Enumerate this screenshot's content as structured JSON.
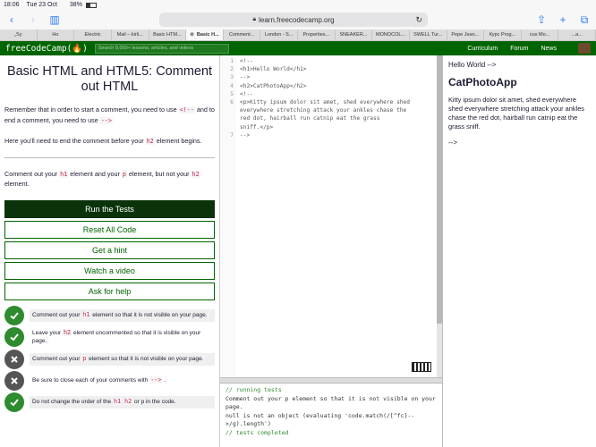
{
  "status": {
    "time": "18:06",
    "date": "Tue 23 Oct",
    "battery": "38%"
  },
  "browser": {
    "url": "learn.freecodecamp.org",
    "tabs": [
      "„Sy",
      "Ho",
      "Electric",
      "Mail – kirli...",
      "Basic HTM...",
      "Basic H...",
      "Comment...",
      "London - S...",
      "Properties...",
      "SNEAKER...",
      "MONOCOL...",
      "SWELL Tur...",
      "Pepe Jean...",
      "Курс Prog...",
      "cus Mo...",
      "...a..."
    ]
  },
  "nav": {
    "brand": "freeCodeCamp(🔥)",
    "search_placeholder": "Search 8,000+ lessons, articles, and videos",
    "links": [
      "Curriculum",
      "Forum",
      "News"
    ]
  },
  "challenge": {
    "title": "Basic HTML and HTML5: Comment out HTML",
    "p1_before": "Remember that in order to start a comment, you need to use ",
    "p1_code1": "<!--",
    "p1_mid": " and to end a comment, you need to use ",
    "p1_code2": "-->",
    "p2_before": "Here you'll need to end the comment before your ",
    "p2_code": "h2",
    "p2_after": " element begins.",
    "p3_a": "Comment out your ",
    "p3_c1": "h1",
    "p3_b": " element and your ",
    "p3_c2": "p",
    "p3_c": " element, but not your ",
    "p3_c3": "h2",
    "p3_d": " element."
  },
  "buttons": {
    "run": "Run the Tests",
    "reset": "Reset All Code",
    "hint": "Get a hint",
    "video": "Watch a video",
    "help": "Ask for help"
  },
  "tests": [
    {
      "status": "pass",
      "a": "Comment out your ",
      "code": "h1",
      "b": " element so that it is not visible on your page.",
      "code2": "",
      "c": ""
    },
    {
      "status": "pass",
      "a": "Leave your ",
      "code": "h2",
      "b": " element uncommented so that it is visible on your page.",
      "code2": "",
      "c": ""
    },
    {
      "status": "fail",
      "a": "Comment out your ",
      "code": "p",
      "b": " element so that it is not visible on your page.",
      "code2": "",
      "c": ""
    },
    {
      "status": "fail",
      "a": "Be sure to close each of your comments with ",
      "code": "-->",
      "b": " .",
      "code2": "",
      "c": ""
    },
    {
      "status": "pass",
      "a": "Do not change the order of the ",
      "code": "h1",
      "b": " ",
      "code2": "h2",
      "c": " or p in the code."
    }
  ],
  "editor": {
    "lines": [
      "<!--",
      "<h1>Hello World</h1>",
      "-->",
      "<h2>CatPhotoApp</h2>",
      "<!--",
      "<p>Kitty ipsum dolor sit amet, shed everywhere shed",
      "everywhere stretching attack your ankles chase the",
      "red dot, hairball run catnip eat the grass",
      "sniff.</p>",
      "-->"
    ],
    "gutter": [
      "1",
      "2",
      "3",
      "4",
      "5",
      "6",
      "",
      "",
      "",
      "7"
    ]
  },
  "output": {
    "l1": "// running tests",
    "l2": "Comment out your p element so that it is not visible on your page.",
    "l3": "null is not an object (evaluating 'code.match(/[^fc]-->/g).length')",
    "l4": "// tests completed"
  },
  "preview": {
    "p1": "Hello World -->",
    "h2": "CatPhotoApp",
    "p2": "Kitty ipsum dolor sit amet, shed everywhere shed everywhere stretching attack your ankles chase the red dot, hairball run catnip eat the grass sniff.",
    "p3": "-->"
  }
}
